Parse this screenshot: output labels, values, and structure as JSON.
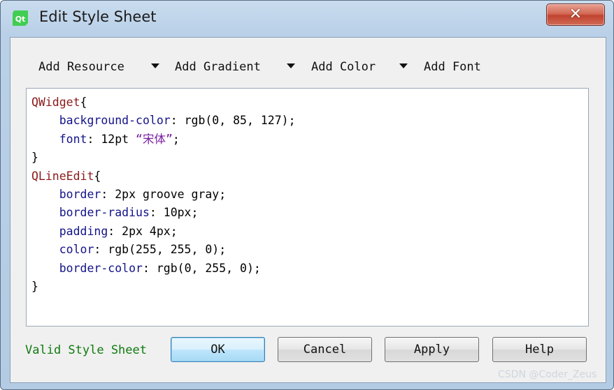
{
  "window": {
    "title": "Edit Style Sheet",
    "close_label": "✕"
  },
  "toolbar": {
    "add_resource": "Add Resource",
    "add_gradient": "Add Gradient",
    "add_color": "Add Color",
    "add_font": "Add Font"
  },
  "editor": {
    "lines": [
      {
        "sel": "QWidget",
        "brace": "{"
      },
      {
        "prop": "background-color",
        "val": ": rgb(0, 85, 127);"
      },
      {
        "prop": "font",
        "val": ": 12pt ",
        "str": "“宋体”",
        "tail": ";"
      },
      {
        "brace": "}"
      },
      {
        "sel": "QLineEdit",
        "brace": "{"
      },
      {
        "prop": "border",
        "val": ": 2px groove gray;"
      },
      {
        "prop": "border-radius",
        "val": ": 10px;"
      },
      {
        "prop": "padding",
        "val": ": 2px 4px;"
      },
      {
        "prop": "color",
        "val": ": rgb(255, 255, 0);"
      },
      {
        "prop": "border-color",
        "val": ": rgb(0, 255, 0);"
      },
      {
        "brace": "}"
      }
    ]
  },
  "status": {
    "text": "Valid Style Sheet"
  },
  "buttons": {
    "ok": "OK",
    "cancel": "Cancel",
    "apply": "Apply",
    "help": "Help"
  },
  "watermark": "CSDN @Coder_Zeus",
  "colors": {
    "selector": "#8b1a1a",
    "property": "#13138a",
    "string": "#7a1fa2",
    "valid": "#0f7a0f"
  }
}
